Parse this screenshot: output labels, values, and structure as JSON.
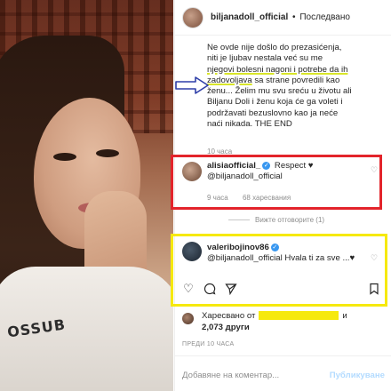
{
  "post": {
    "username": "biljanadoll_official",
    "separator": "•",
    "follow_label": "Последвано"
  },
  "caption": {
    "line1": "Ne ovde nije došlo do prezasićenja,",
    "line2": "niti je ljubav nestala već su me",
    "line3": "njegovi bolesni nagoni i potrebe da ih",
    "line4": "zadovoljava",
    "line4_rest": " sa strane povredili kao",
    "line5": "ženu... Želim mu svu sreću u životu ali",
    "line6": "Biljanu Doli i ženu koja će ga voleti i",
    "line7": "podržavati bezuslovno kao ja neće",
    "line8": "naći nikada. THE END",
    "time": "10 часа"
  },
  "comments": [
    {
      "username": "alisiaofficial_",
      "verified": "✓",
      "text": " Respect ♥",
      "mention": "@biljanadoll_official",
      "time": "9 часа",
      "likes": "68 харесвания"
    },
    {
      "username": "valeribojinov86",
      "verified": "✓",
      "text": "@biljanadoll_official Hvala ti za sve ...♥"
    }
  ],
  "view_replies": "Вижте отговорите (1)",
  "likes": {
    "prefix": "Харесвано от",
    "suffix": "и",
    "others": "2,073 други"
  },
  "time_ago": "ПРЕДИ 10 ЧАСА",
  "add_comment": {
    "placeholder": "Добавяне на коментар...",
    "publish": "Публикуване"
  },
  "photo": {
    "sweater_text": "OSSUB"
  },
  "colors": {
    "red_box": "#e3242b",
    "yellow_box": "#f6e90e",
    "arrow": "#2f3fa8",
    "verified": "#3897f0"
  },
  "icons": {
    "like": "heart-icon",
    "comment": "comment-icon",
    "share": "share-icon",
    "save": "bookmark-icon"
  }
}
